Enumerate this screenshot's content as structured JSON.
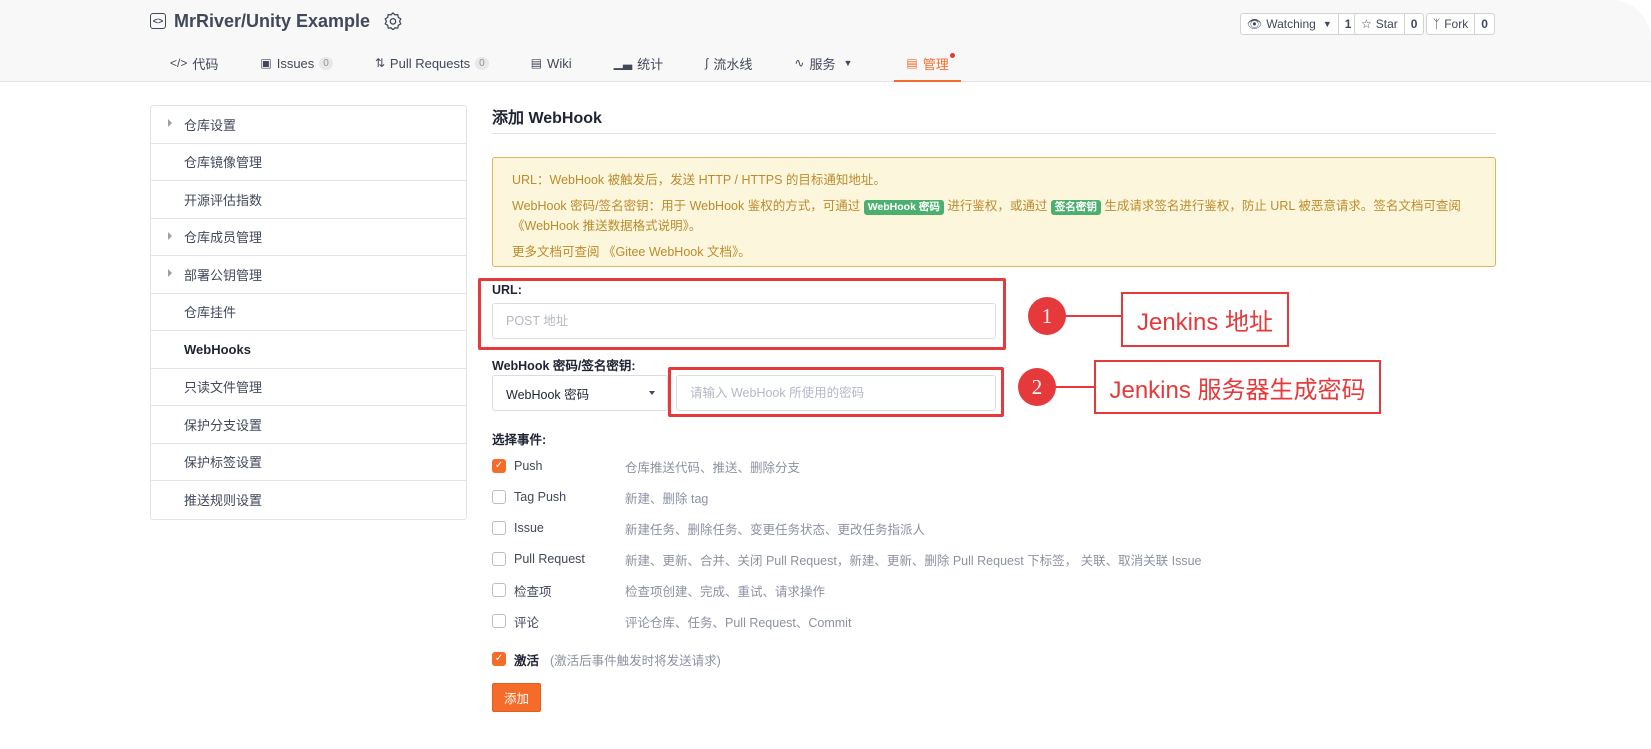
{
  "repo": {
    "title": "MrRiver/Unity Example",
    "repo_icon": "code-repo-icon",
    "badge_icon": "certified-badge-icon"
  },
  "social": {
    "watching_label": "Watching",
    "watching_count": "1",
    "star_label": "Star",
    "star_count": "0",
    "fork_label": "Fork",
    "fork_count": "0"
  },
  "tabs": {
    "code": "代码",
    "issues": "Issues",
    "issues_count": "0",
    "pulls": "Pull Requests",
    "pulls_count": "0",
    "wiki": "Wiki",
    "stats": "统计",
    "pipeline": "流水线",
    "services": "服务",
    "manage": "管理"
  },
  "sidebar": {
    "items": [
      {
        "label": "仓库设置"
      },
      {
        "label": "仓库镜像管理"
      },
      {
        "label": "开源评估指数"
      },
      {
        "label": "仓库成员管理"
      },
      {
        "label": "部署公钥管理"
      },
      {
        "label": "仓库挂件"
      },
      {
        "label": "WebHooks"
      },
      {
        "label": "只读文件管理"
      },
      {
        "label": "保护分支设置"
      },
      {
        "label": "保护标签设置"
      },
      {
        "label": "推送规则设置"
      }
    ]
  },
  "main": {
    "title": "添加 WebHook",
    "notice": {
      "line1": "URL：WebHook 被触发后，发送 HTTP / HTTPS 的目标通知地址。",
      "line2_a": "WebHook 密码/签名密钥：用于 WebHook 鉴权的方式，可通过",
      "tag1": "WebHook 密码",
      "line2_b": "进行鉴权，或通过",
      "tag2": "签名密钥",
      "line2_c": "生成请求签名进行鉴权，防止 URL 被恶意请求。签名文档可查阅",
      "line2_d": "《WebHook 推送数据格式说明》。",
      "line3": "更多文档可查阅 《Gitee WebHook 文档》。"
    },
    "url_label": "URL:",
    "url_placeholder": "POST 地址",
    "secret_label": "WebHook 密码/签名密钥:",
    "secret_type": "WebHook 密码",
    "secret_placeholder": "请输入 WebHook 所使用的密码",
    "events_label": "选择事件:",
    "events": [
      {
        "name": "Push",
        "desc": "仓库推送代码、推送、删除分支",
        "checked": true
      },
      {
        "name": "Tag Push",
        "desc": "新建、删除 tag",
        "checked": false
      },
      {
        "name": "Issue",
        "desc": "新建任务、删除任务、变更任务状态、更改任务指派人",
        "checked": false
      },
      {
        "name": "Pull Request",
        "desc": "新建、更新、合并、关闭 Pull Request，新建、更新、删除 Pull Request 下标签， 关联、取消关联 Issue",
        "checked": false
      },
      {
        "name": "检查项",
        "desc": "检查项创建、完成、重试、请求操作",
        "checked": false
      },
      {
        "name": "评论",
        "desc": "评论仓库、任务、Pull Request、Commit",
        "checked": false
      }
    ],
    "active_label": "激活",
    "active_hint": "(激活后事件触发时将发送请求)",
    "add_button": "添加"
  },
  "annotations": {
    "one": "1",
    "one_text": "Jenkins 地址",
    "two": "2",
    "two_text": "Jenkins 服务器生成密码",
    "color": "#e5393b"
  }
}
